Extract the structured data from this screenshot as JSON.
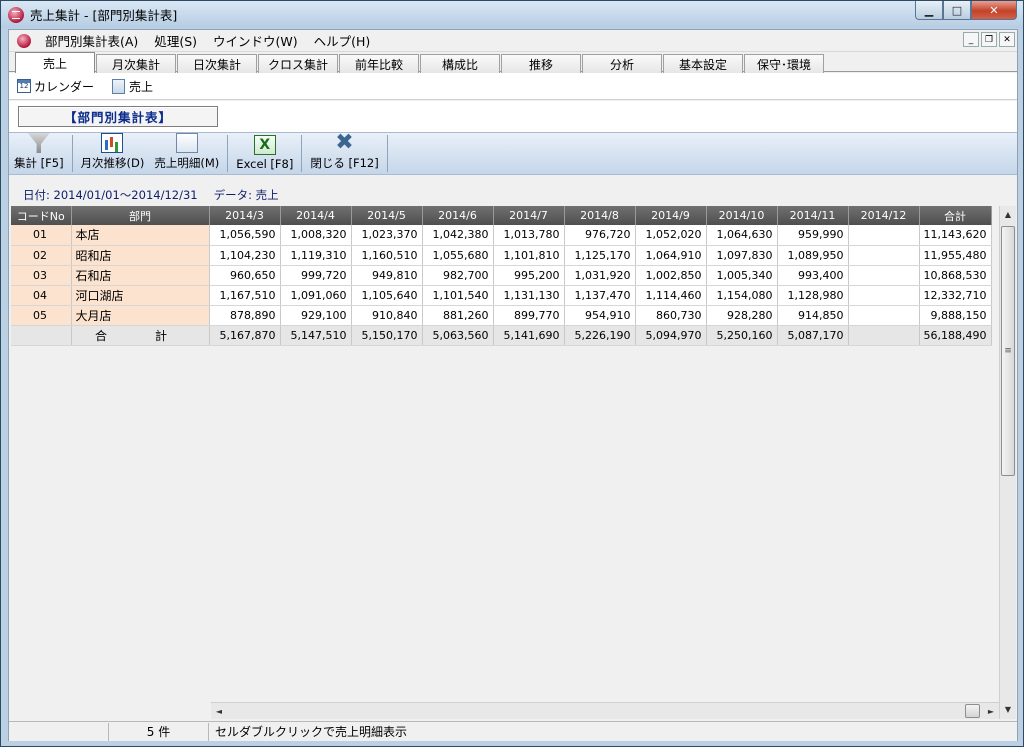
{
  "window": {
    "title": "売上集計 - [部門別集計表]",
    "controls": [
      "0",
      "1",
      "r"
    ]
  },
  "menu": {
    "items": [
      "部門別集計表(A)",
      "処理(S)",
      "ウインドウ(W)",
      "ヘルプ(H)"
    ]
  },
  "tabs": [
    {
      "label": "売上",
      "active": true
    },
    {
      "label": "月次集計"
    },
    {
      "label": "日次集計"
    },
    {
      "label": "クロス集計"
    },
    {
      "label": "前年比較"
    },
    {
      "label": "構成比"
    },
    {
      "label": "推移"
    },
    {
      "label": "分析"
    },
    {
      "label": "基本設定"
    },
    {
      "label": "保守･環境"
    }
  ],
  "subnav": {
    "calendar": "カレンダー",
    "calendar_icon_text": "12",
    "sales": "売上"
  },
  "report_title": "【部門別集計表】",
  "toolbar": {
    "aggregate": "集計 [F5]",
    "monthly_trend": "月次推移(D)",
    "sales_detail": "売上明細(M)",
    "excel": "Excel [F8]",
    "excel_icon_text": "X",
    "close": "閉じる [F12]"
  },
  "info": {
    "date": "日付: 2014/01/01～2014/12/31",
    "data": "データ: 売上"
  },
  "grid": {
    "headers": [
      "コードNo",
      "部門",
      "2014/3",
      "2014/4",
      "2014/5",
      "2014/6",
      "2014/7",
      "2014/8",
      "2014/9",
      "2014/10",
      "2014/11",
      "2014/12",
      "合計"
    ],
    "rows": [
      [
        "01",
        "本店",
        "1,056,590",
        "1,008,320",
        "1,023,370",
        "1,042,380",
        "1,013,780",
        "976,720",
        "1,052,020",
        "1,064,630",
        "959,990",
        "",
        "11,143,620"
      ],
      [
        "02",
        "昭和店",
        "1,104,230",
        "1,119,310",
        "1,160,510",
        "1,055,680",
        "1,101,810",
        "1,125,170",
        "1,064,910",
        "1,097,830",
        "1,089,950",
        "",
        "11,955,480"
      ],
      [
        "03",
        "石和店",
        "960,650",
        "999,720",
        "949,810",
        "982,700",
        "995,200",
        "1,031,920",
        "1,002,850",
        "1,005,340",
        "993,400",
        "",
        "10,868,530"
      ],
      [
        "04",
        "河口湖店",
        "1,167,510",
        "1,091,060",
        "1,105,640",
        "1,101,540",
        "1,131,130",
        "1,137,470",
        "1,114,460",
        "1,154,080",
        "1,128,980",
        "",
        "12,332,710"
      ],
      [
        "05",
        "大月店",
        "878,890",
        "929,100",
        "910,840",
        "881,260",
        "899,770",
        "954,910",
        "860,730",
        "928,280",
        "914,850",
        "",
        "9,888,150"
      ]
    ],
    "total": [
      "",
      "合　計",
      "5,167,870",
      "5,147,510",
      "5,150,170",
      "5,063,560",
      "5,141,690",
      "5,226,190",
      "5,094,970",
      "5,250,160",
      "5,087,170",
      "",
      "56,188,490"
    ]
  },
  "scroll": {
    "up": "▲",
    "down": "▼",
    "left": "◄",
    "right": "►",
    "grip": "≡"
  },
  "status": {
    "count": "5 件",
    "hint": "セルダブルクリックで売上明細表示"
  }
}
